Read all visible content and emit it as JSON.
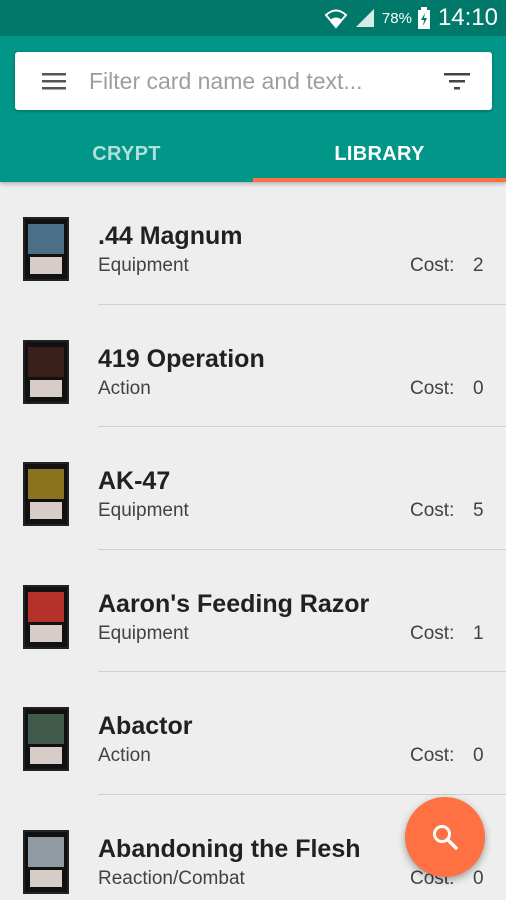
{
  "status_bar": {
    "battery_text": "78%",
    "time": "14:10",
    "icons": [
      "wifi-icon",
      "signal-icon",
      "battery-charging-icon"
    ]
  },
  "search": {
    "placeholder": "Filter card name and text...",
    "value": ""
  },
  "tabs": [
    {
      "label": "CRYPT",
      "selected": false
    },
    {
      "label": "LIBRARY",
      "selected": true
    }
  ],
  "cost_label": "Cost:",
  "cards": [
    {
      "name": ".44 Magnum",
      "type": "Equipment",
      "cost": "2",
      "art_color": "#4a6f86"
    },
    {
      "name": "419 Operation",
      "type": "Action",
      "cost": "0",
      "art_color": "#3b1f1a"
    },
    {
      "name": "AK-47",
      "type": "Equipment",
      "cost": "5",
      "art_color": "#8a7420"
    },
    {
      "name": "Aaron's Feeding Razor",
      "type": "Equipment",
      "cost": "1",
      "art_color": "#b5322a"
    },
    {
      "name": "Abactor",
      "type": "Action",
      "cost": "0",
      "art_color": "#3f5a4a"
    },
    {
      "name": "Abandoning the Flesh",
      "type": "Reaction/Combat",
      "cost": "0",
      "art_color": "#8f9aa3"
    }
  ],
  "colors": {
    "status_bar": "#00796b",
    "app_bar": "#009688",
    "accent": "#ff7043"
  }
}
